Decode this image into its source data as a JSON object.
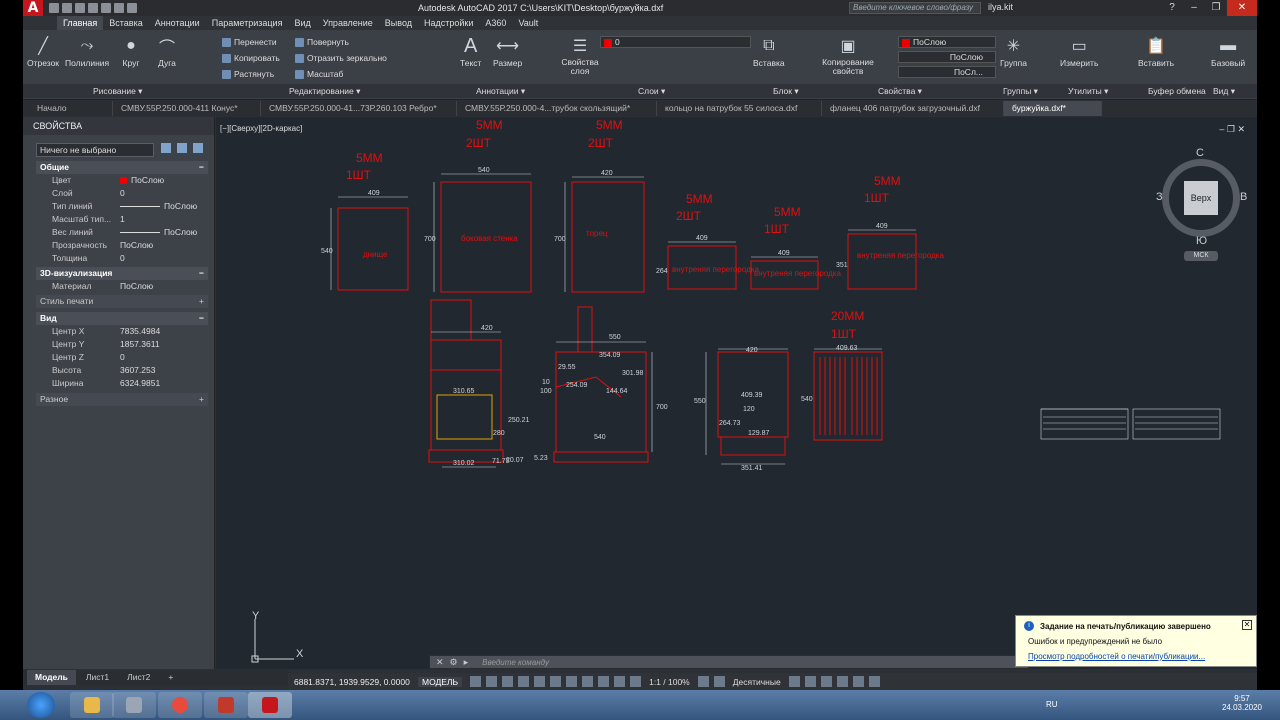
{
  "app": {
    "title": "Autodesk AutoCAD 2017   C:\\Users\\KIT\\Desktop\\буржуйка.dxf",
    "search_placeholder": "Введите ключевое слово/фразу",
    "user": "ilya.kit"
  },
  "ribbon_tabs": [
    "Главная",
    "Вставка",
    "Аннотации",
    "Параметризация",
    "Вид",
    "Управление",
    "Вывод",
    "Надстройки",
    "A360",
    "Vault"
  ],
  "ribbon": {
    "draw": {
      "line": "Отрезок",
      "polyline": "Полилиния",
      "circle": "Круг",
      "arc": "Дуга"
    },
    "modify": {
      "move": "Перенести",
      "rotate": "Повернуть",
      "copy": "Копировать",
      "mirror": "Отразить зеркально",
      "stretch": "Растянуть",
      "scale": "Масштаб"
    },
    "annotation": {
      "text": "Текст",
      "dimension": "Размер"
    },
    "layers": {
      "props": "Свойства слоя",
      "layer_value": "0"
    },
    "block": {
      "insert": "Вставка"
    },
    "properties": {
      "match": "Копирование свойств",
      "color": "ПоСлою",
      "linetype": "ПоСлою",
      "lineweight": "ПоСл..."
    },
    "groups": {
      "group": "Группа"
    },
    "utilities": {
      "measure": "Измерить"
    },
    "clipboard": {
      "paste": "Вставить"
    },
    "view": {
      "base": "Базовый"
    },
    "groups_labels": [
      "Рисование ▾",
      "Редактирование ▾",
      "Аннотации ▾",
      "Слои ▾",
      "Блок ▾",
      "Свойства ▾",
      "Группы ▾",
      "Утилиты ▾",
      "Буфер обмена",
      "Вид ▾"
    ]
  },
  "file_tabs": [
    "Начало",
    "СМВУ.55Р.250.000-411 Конус*",
    "СМВУ.55Р.250.000-41...73Р.260.103 Ребро*",
    "СМВУ.55Р.250.000-4...трубок скользящий*",
    "кольцо на патрубок 55 силоса.dxf",
    "фланец 406 патрубок загрузочный.dxf",
    "буржуйка.dxf*"
  ],
  "properties_panel": {
    "title": "СВОЙСТВА",
    "selection": "Ничего не выбрано",
    "sections": {
      "general": "Общие",
      "viz3d": "3D-визуализация",
      "plotstyle": "Стиль печати",
      "view": "Вид",
      "misc": "Разное"
    },
    "general_rows": [
      {
        "k": "Цвет",
        "v": "ПоСлою"
      },
      {
        "k": "Слой",
        "v": "0"
      },
      {
        "k": "Тип линий",
        "v": "ПоСлою"
      },
      {
        "k": "Масштаб тип...",
        "v": "1"
      },
      {
        "k": "Вес линий",
        "v": "ПоСлою"
      },
      {
        "k": "Прозрачность",
        "v": "ПоСлою"
      },
      {
        "k": "Толщина",
        "v": "0"
      }
    ],
    "material": {
      "k": "Материал",
      "v": "ПоСлою"
    },
    "view_rows": [
      {
        "k": "Центр X",
        "v": "7835.4984"
      },
      {
        "k": "Центр Y",
        "v": "1857.3611"
      },
      {
        "k": "Центр Z",
        "v": "0"
      },
      {
        "k": "Высота",
        "v": "3607.253"
      },
      {
        "k": "Ширина",
        "v": "6324.9851"
      }
    ]
  },
  "viewport": {
    "label": "[−][Сверху][2D-каркас]",
    "cube": {
      "top_face": "Верх",
      "n": "С",
      "s": "Ю",
      "w": "З",
      "e": "В",
      "wcs": "МСК"
    }
  },
  "drawing": {
    "annotations": [
      {
        "id": "a1",
        "t1": "5ММ",
        "t2": "1ШТ"
      },
      {
        "id": "a2",
        "t1": "5ММ",
        "t2": "2ШТ"
      },
      {
        "id": "a3",
        "t1": "5ММ",
        "t2": "2ШТ"
      },
      {
        "id": "a4",
        "t1": "5ММ",
        "t2": "2ШТ"
      },
      {
        "id": "a5",
        "t1": "5ММ",
        "t2": "1ШТ"
      },
      {
        "id": "a6",
        "t1": "5ММ",
        "t2": "1ШТ"
      },
      {
        "id": "a7",
        "t1": "20ММ",
        "t2": "1ШТ"
      }
    ],
    "parts": [
      {
        "name": "днище",
        "w": "409",
        "h": "540"
      },
      {
        "name": "боковая стенка",
        "w": "540",
        "h": "700"
      },
      {
        "name": "торец",
        "w": "420",
        "h": "700"
      },
      {
        "name": "внутреняя перегородка",
        "w": "409",
        "h": "264"
      },
      {
        "name": "внутреняя перегородка",
        "w": "409",
        "h": ""
      },
      {
        "name": "внутреняя перегородка",
        "w": "409",
        "h": "351"
      }
    ],
    "dims": [
      "420",
      "310.65",
      "310.02",
      "250.21",
      "280",
      "71.75",
      "20.07",
      "550",
      "354.09",
      "29.55",
      "10",
      "100",
      "254.09",
      "301.98",
      "144.64",
      "700",
      "540",
      "5.23",
      "420",
      "409.39",
      "120",
      "264.73",
      "129.87",
      "550",
      "351.41",
      "409.63",
      "540"
    ]
  },
  "command_prompt": "Введите команду",
  "layout_tabs": [
    "Модель",
    "Лист1",
    "Лист2",
    "+"
  ],
  "status": {
    "coords": "6881.8371, 1939.9529, 0.0000",
    "model": "МОДЕЛЬ",
    "scale": "1:1 / 100%",
    "units": "Десятичные"
  },
  "notification": {
    "title": "Задание на печать/публикацию завершено",
    "message": "Ошибок и предупреждений не было",
    "link": "Просмотр подробностей о печати/публикации..."
  },
  "taskbar": {
    "lang": "RU",
    "time": "9:57",
    "date": "24.03.2020"
  },
  "colors": {
    "accent_red": "#e01010",
    "canvas": "#212830"
  }
}
